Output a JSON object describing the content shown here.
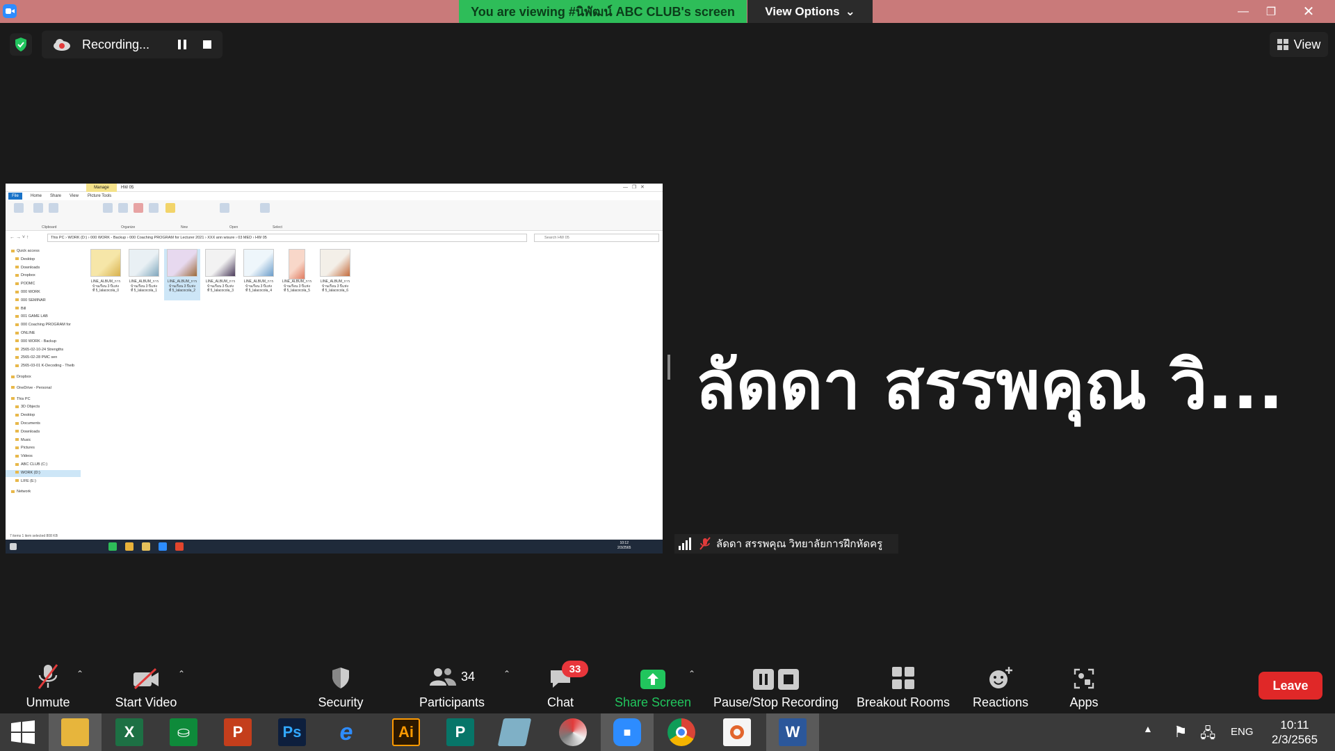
{
  "titlebar": {
    "banner": "You are viewing #นิพัฒน์ ABC CLUB's screen",
    "view_options": "View Options"
  },
  "recording": {
    "label": "Recording..."
  },
  "view_button": {
    "label": "View"
  },
  "shared_screen": {
    "ribbon_context_tab": "Manage",
    "folder_title": "HW 05",
    "tabs": [
      "File",
      "Home",
      "Share",
      "View",
      "Picture Tools"
    ],
    "ribbon_groups": [
      "Clipboard",
      "Organize",
      "New",
      "Open",
      "Select"
    ],
    "address": "This PC  ›  WORK (D:)  ›  000 WORK - Backup  ›  000 Coaching PROGRAM for Lecturer 2021  ›  XXX ann wisure  ›  03 MED  ›  HW 05",
    "search_placeholder": "Search HW 05",
    "nav": [
      "Quick access",
      "Desktop",
      "Downloads",
      "Dropbox",
      "PODMC",
      "000 WORK",
      "000 SEMINAR",
      "Bill",
      "001 GAME LAB",
      "000 Coaching PROGRAM for",
      "ONLINE",
      "000 WORK - Backup",
      "2565-02-10-24 Strengths",
      "2565-02-28 PMC sen",
      "2565-03-01 K-Decoding - Theib",
      "Dropbox",
      "OneDrive - Personal",
      "This PC",
      "3D Objects",
      "Desktop",
      "Documents",
      "Downloads",
      "Music",
      "Pictures",
      "Videos",
      "ABC CLUB (C:)",
      "WORK (D:)",
      "LIFE (E:)",
      "Network"
    ],
    "files": [
      {
        "line1": "LINE_ALBUM_การ",
        "line2": "บ้านเรือน 3 ปีแห่ง",
        "line3": "ที่ 5_lalacocola_0"
      },
      {
        "line1": "LINE_ALBUM_การ",
        "line2": "บ้านเรือน 3 ปีแห่ง",
        "line3": "ที่ 5_lalacocola_1"
      },
      {
        "line1": "LINE_ALBUM_การ",
        "line2": "บ้านเรือน 3 ปีแห่ง",
        "line3": "ที่ 5_lalacocola_2"
      },
      {
        "line1": "LINE_ALBUM_การ",
        "line2": "บ้านเรือน 3 ปีแห่ง",
        "line3": "ที่ 5_lalacocola_3"
      },
      {
        "line1": "LINE_ALBUM_การ",
        "line2": "บ้านเรือน 3 ปีแห่ง",
        "line3": "ที่ 5_lalacocola_4"
      },
      {
        "line1": "LINE_ALBUM_การ",
        "line2": "บ้านเรือน 3 ปีแห่ง",
        "line3": "ที่ 5_lalacocola_5"
      },
      {
        "line1": "LINE_ALBUM_การ",
        "line2": "บ้านเรือน 3 ปีแห่ง",
        "line3": "ที่ 5_lalacocola_6"
      }
    ],
    "status": "7 items     1 item selected  808 KB",
    "taskbar_time": "10:12",
    "taskbar_date": "2/3/2565"
  },
  "speaker": {
    "display_name": "ลัดดา สรรพคุณ วิ...",
    "name_tag": "ลัดดา สรรพคุณ วิทยาลัยการฝึกหัดครู"
  },
  "controls": {
    "unmute": "Unmute",
    "start_video": "Start Video",
    "security": "Security",
    "participants": "Participants",
    "participants_count": "34",
    "chat": "Chat",
    "chat_badge": "33",
    "share_screen": "Share Screen",
    "pause_stop": "Pause/Stop Recording",
    "breakout": "Breakout Rooms",
    "reactions": "Reactions",
    "apps": "Apps",
    "leave": "Leave"
  },
  "taskbar": {
    "lang": "ENG",
    "time": "10:11",
    "date": "2/3/2565"
  },
  "colors": {
    "titlebar": "#c97a7a",
    "banner": "#2ebd59",
    "share_green": "#21c55d",
    "leave_red": "#e02828",
    "badge_red": "#e8363b"
  }
}
